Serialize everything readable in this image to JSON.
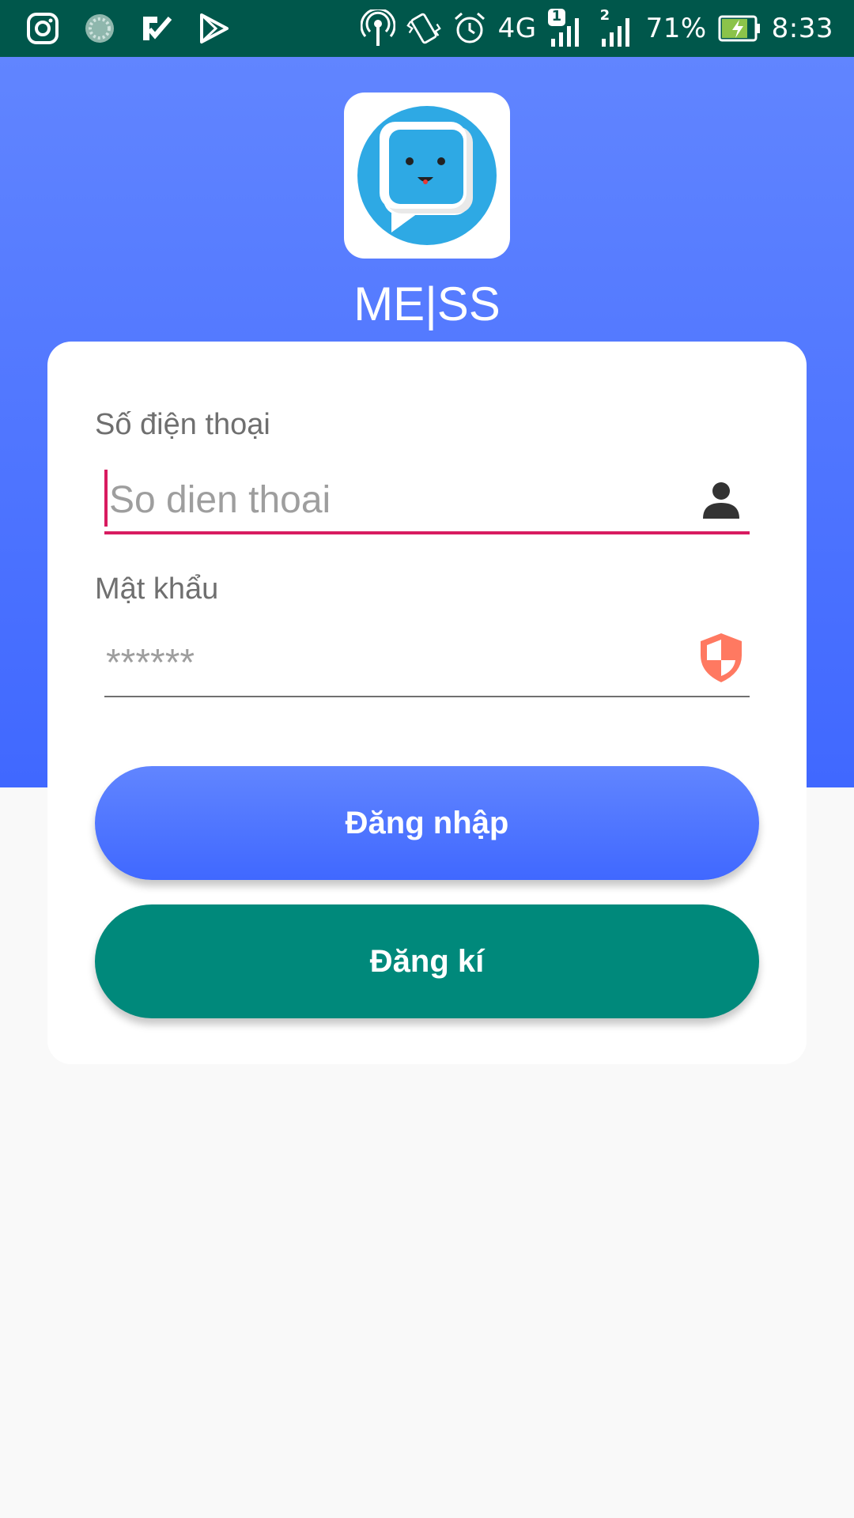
{
  "status_bar": {
    "sim1_badge": "1",
    "sim2_badge": "2",
    "network": "4G",
    "battery": "71%",
    "time": "8:33",
    "icons_left": [
      "instagram-icon",
      "loading-icon",
      "check-app-icon",
      "play-store-icon"
    ],
    "icons_right": [
      "hotspot-icon",
      "vibrate-icon",
      "alarm-icon",
      "signal-icon",
      "battery-icon"
    ]
  },
  "header": {
    "app_name": "ME|SS"
  },
  "form": {
    "phone_label": "Số điện thoại",
    "phone_placeholder": "So dien thoai",
    "password_label": "Mật khẩu",
    "password_placeholder": "******",
    "login_button": "Đăng nhập",
    "register_button": "Đăng kí"
  },
  "colors": {
    "status_bar": "#00574b",
    "header_gradient_top": "#6185ff",
    "header_gradient_bottom": "#4068ff",
    "focus_accent": "#d81b60",
    "register_button": "#00897b",
    "shield_icon": "#ff7961"
  }
}
